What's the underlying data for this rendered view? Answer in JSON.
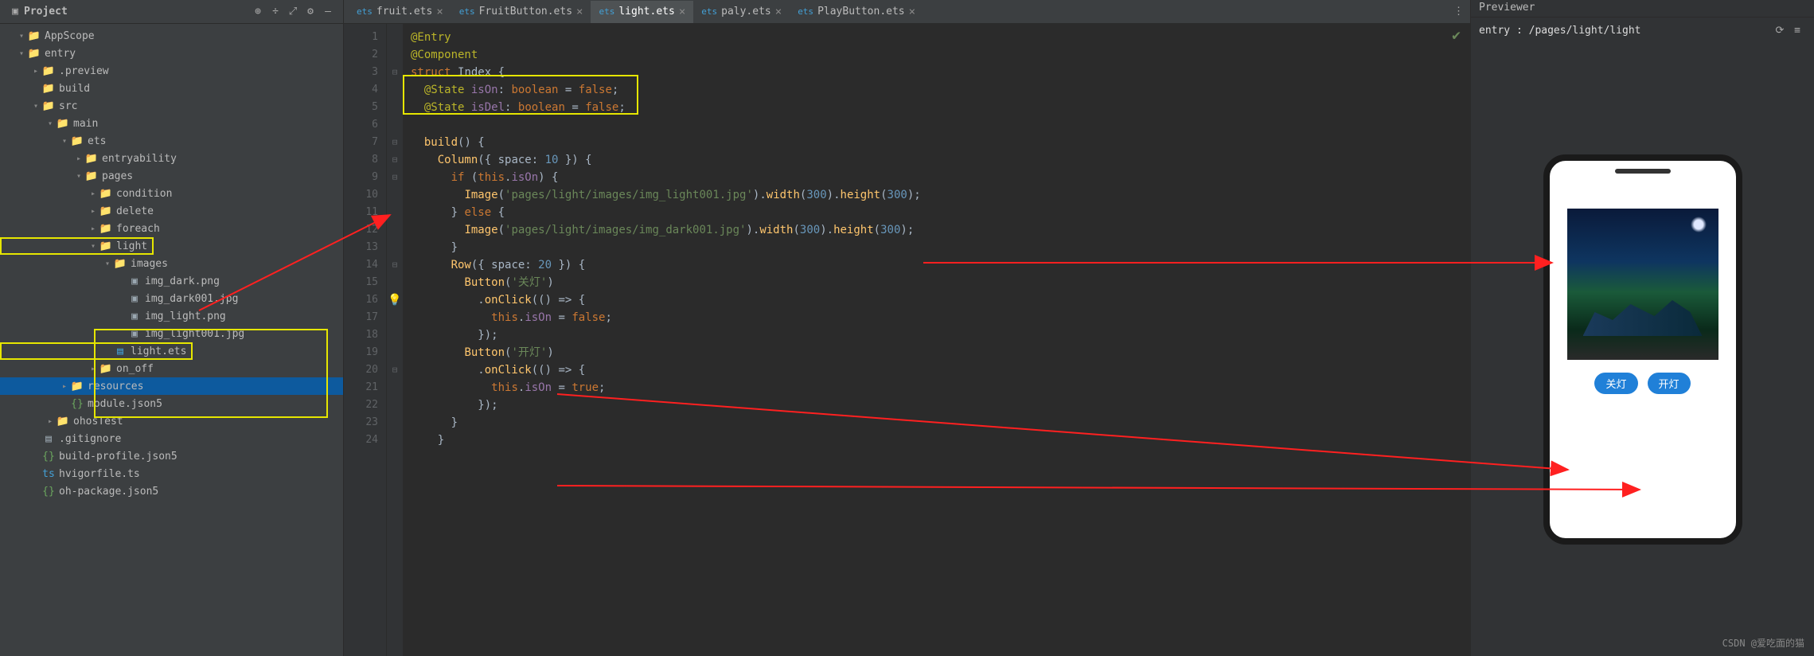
{
  "project": {
    "title": "Project",
    "tree": [
      {
        "indent": 0,
        "expand": "▼",
        "icon": "folder-blue",
        "label": "AppScope"
      },
      {
        "indent": 0,
        "expand": "▼",
        "icon": "folder-blue",
        "label": "entry",
        "bold": true
      },
      {
        "indent": 1,
        "expand": "▶",
        "icon": "folder-orange",
        "label": ".preview"
      },
      {
        "indent": 1,
        "expand": "",
        "icon": "folder-orange",
        "label": "build"
      },
      {
        "indent": 1,
        "expand": "▼",
        "icon": "folder-blue",
        "label": "src"
      },
      {
        "indent": 2,
        "expand": "▼",
        "icon": "folder-blue",
        "label": "main"
      },
      {
        "indent": 3,
        "expand": "▼",
        "icon": "folder",
        "label": "ets"
      },
      {
        "indent": 4,
        "expand": "▶",
        "icon": "folder",
        "label": "entryability"
      },
      {
        "indent": 4,
        "expand": "▼",
        "icon": "folder",
        "label": "pages"
      },
      {
        "indent": 5,
        "expand": "▶",
        "icon": "folder",
        "label": "condition"
      },
      {
        "indent": 5,
        "expand": "▶",
        "icon": "folder",
        "label": "delete"
      },
      {
        "indent": 5,
        "expand": "▶",
        "icon": "folder",
        "label": "foreach"
      },
      {
        "indent": 5,
        "expand": "▼",
        "icon": "folder",
        "label": "light",
        "hl": true
      },
      {
        "indent": 6,
        "expand": "▼",
        "icon": "folder",
        "label": "images"
      },
      {
        "indent": 7,
        "expand": "",
        "icon": "file-img",
        "label": "img_dark.png"
      },
      {
        "indent": 7,
        "expand": "",
        "icon": "file-img",
        "label": "img_dark001.jpg"
      },
      {
        "indent": 7,
        "expand": "",
        "icon": "file-img",
        "label": "img_light.png"
      },
      {
        "indent": 7,
        "expand": "",
        "icon": "file-img",
        "label": "img_light001.jpg"
      },
      {
        "indent": 6,
        "expand": "",
        "icon": "file-ets",
        "label": "light.ets",
        "hl": true
      },
      {
        "indent": 5,
        "expand": "▶",
        "icon": "folder",
        "label": "on_off"
      },
      {
        "indent": 3,
        "expand": "▶",
        "icon": "folder",
        "label": "resources",
        "selected": true
      },
      {
        "indent": 3,
        "expand": "",
        "icon": "file-json",
        "label": "module.json5"
      },
      {
        "indent": 2,
        "expand": "▶",
        "icon": "folder",
        "label": "ohosTest"
      },
      {
        "indent": 1,
        "expand": "",
        "icon": "file",
        "label": ".gitignore"
      },
      {
        "indent": 1,
        "expand": "",
        "icon": "file-json",
        "label": "build-profile.json5"
      },
      {
        "indent": 1,
        "expand": "",
        "icon": "file-ts",
        "label": "hvigorfile.ts"
      },
      {
        "indent": 1,
        "expand": "",
        "icon": "file-json",
        "label": "oh-package.json5"
      }
    ]
  },
  "tabs": [
    {
      "label": "fruit.ets",
      "active": false
    },
    {
      "label": "FruitButton.ets",
      "active": false
    },
    {
      "label": "light.ets",
      "active": true
    },
    {
      "label": "paly.ets",
      "active": false
    },
    {
      "label": "PlayButton.ets",
      "active": false
    }
  ],
  "code": {
    "lines": [
      {
        "n": 1,
        "html": "<span class='ann'>@Entry</span>"
      },
      {
        "n": 2,
        "html": "<span class='ann'>@Component</span>"
      },
      {
        "n": 3,
        "html": "<span class='kw'>struct</span> <span class='cls'>Index</span> {"
      },
      {
        "n": 4,
        "html": "  <span class='ann'>@State</span> <span class='prop'>isOn</span>: <span class='kw'>boolean</span> = <span class='bool'>false</span>;"
      },
      {
        "n": 5,
        "html": "  <span class='ann'>@State</span> <span class='prop'>isDel</span>: <span class='kw'>boolean</span> = <span class='bool'>false</span>;"
      },
      {
        "n": 6,
        "html": ""
      },
      {
        "n": 7,
        "html": "  <span class='fn'>build</span>() {"
      },
      {
        "n": 8,
        "html": "    <span class='fn'>Column</span>({ space: <span class='num'>10</span> }) {"
      },
      {
        "n": 9,
        "html": "      <span class='kw'>if</span> (<span class='kw'>this</span>.<span class='prop'>isOn</span>) {"
      },
      {
        "n": 10,
        "html": "        <span class='fn'>Image</span>(<span class='str'>'pages/light/images/img_light001.jpg'</span>).<span class='fn'>width</span>(<span class='num'>300</span>).<span class='fn'>height</span>(<span class='num'>300</span>);"
      },
      {
        "n": 11,
        "html": "      } <span class='kw'>else</span> {"
      },
      {
        "n": 12,
        "html": "        <span class='fn'>Image</span>(<span class='str'>'pages/light/images/img_dark001.jpg'</span>).<span class='fn'>width</span>(<span class='num'>300</span>).<span class='fn'>height</span>(<span class='num'>300</span>);"
      },
      {
        "n": 13,
        "html": "      }"
      },
      {
        "n": 14,
        "html": "      <span class='fn'>Row</span>({ space: <span class='num'>20</span> }) {"
      },
      {
        "n": 15,
        "html": "        <span class='fn'>Button</span>(<span class='str'>'关灯'</span>)"
      },
      {
        "n": 16,
        "html": "          .<span class='fn'>onClick</span>(() =&gt; {"
      },
      {
        "n": 17,
        "html": "            <span class='kw'>this</span>.<span class='prop'>isOn</span> = <span class='bool'>false</span>;"
      },
      {
        "n": 18,
        "html": "          });"
      },
      {
        "n": 19,
        "html": "        <span class='fn'>Button</span>(<span class='str'>'开灯'</span>)"
      },
      {
        "n": 20,
        "html": "          .<span class='fn'>onClick</span>(() =&gt; {"
      },
      {
        "n": 21,
        "html": "            <span class='kw'>this</span>.<span class='prop'>isOn</span> = <span class='bool'>true</span>;"
      },
      {
        "n": 22,
        "html": "          });"
      },
      {
        "n": 23,
        "html": "      }"
      },
      {
        "n": 24,
        "html": "    }"
      }
    ]
  },
  "previewer": {
    "title": "Previewer",
    "path": "entry : /pages/light/light",
    "btn_off": "关灯",
    "btn_on": "开灯"
  },
  "watermark": "CSDN @爱吃面的猫"
}
